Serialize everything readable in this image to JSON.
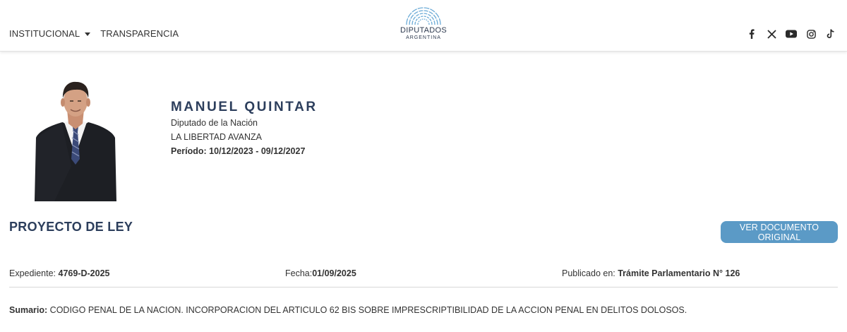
{
  "nav": {
    "items": [
      {
        "label": "INSTITUCIONAL",
        "has_dropdown": true
      },
      {
        "label": "TRANSPARENCIA",
        "has_dropdown": false
      }
    ]
  },
  "logo": {
    "name": "DIPUTADOS",
    "subtitle": "ARGENTINA"
  },
  "social_icons": [
    "facebook-icon",
    "x-icon",
    "youtube-icon",
    "instagram-icon",
    "tiktok-icon"
  ],
  "profile": {
    "name": "MANUEL QUINTAR",
    "role": "Diputado de la Nación",
    "party": "LA LIBERTAD AVANZA",
    "period_label": "Período: 10/12/2023 - 09/12/2027"
  },
  "project": {
    "title": "PROYECTO DE LEY",
    "button_label": "VER DOCUMENTO ORIGINAL",
    "expediente_label": "Expediente: ",
    "expediente_value": "4769-D-2025",
    "fecha_label": "Fecha:",
    "fecha_value": "01/09/2025",
    "publicado_label": "Publicado en: ",
    "publicado_value": "Trámite Parlamentario N° 126",
    "sumario_label": "Sumario:",
    "sumario_value": " CODIGO PENAL DE LA NACION. INCORPORACION DEL ARTICULO 62 BIS SOBRE IMPRESCRIPTIBILIDAD DE LA ACCION PENAL EN DELITOS DOLOSOS."
  },
  "colors": {
    "accent": "#2c3e5c",
    "button": "#5b9ac6",
    "logo_blue": "#6aaad6"
  }
}
